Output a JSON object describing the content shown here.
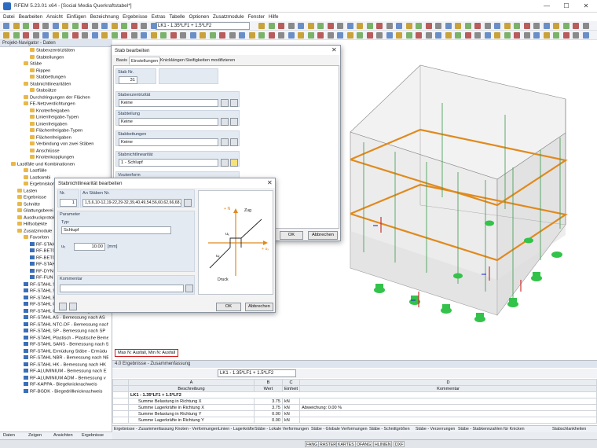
{
  "window": {
    "title": "RFEM 5.23.01 x64 - [Social Media Querkraftstabel*]",
    "minimize": "—",
    "maximize": "☐",
    "close": "✕"
  },
  "menu": [
    "Datei",
    "Bearbeiten",
    "Ansicht",
    "Einfügen",
    "Bezeichnung",
    "Ergebnisse",
    "Extras",
    "Tabelle",
    "Optionen",
    "Zusatzmodule",
    "Fenster",
    "Hilfe"
  ],
  "toolbar": {
    "loadcase_combo": "LK1 - 1.35*LF1 + 1.5*LF2",
    "result_combo": "LK1 - 1.35*LF1 + 1.5*LF2"
  },
  "navigator": {
    "title": "Projekt-Navigator - Daten",
    "items": [
      "Stabexzentrizitäten",
      "Stabteilungen",
      "Stäbe",
      "Rippen",
      "Stabbettungen",
      "Stabnichtlinearitäten",
      "Stabsätze",
      "Durchdringungen der Flächen",
      "FE-Netzverdichtungen",
      "Knotenfreigaben",
      "Linienfreigabe-Typen",
      "Linienfreigaben",
      "Flächenfreigabe-Typen",
      "Flächenfreigaben",
      "Verbindung von zwei Stäben",
      "Anschlüsse",
      "Knotenkopplungen",
      "Lastfälle und Kombinationen",
      "Lastfälle",
      "Lastkombi",
      "Ergebniskom",
      "Lasten",
      "Ergebnisse",
      "Schnitte",
      "Glattungsberei",
      "Ausdruckprotok",
      "Hilfsobjekte",
      "Zusatzmodule",
      "Favoriten",
      "RF-STAH",
      "RF-BETO",
      "RF-BETO",
      "RF-STAH",
      "RF-DYN",
      "RF-FUN",
      "RF-STAHL Stäbe",
      "RF-STAHL SIA - Bemessung nach SIA",
      "RF-STAHL BS - Bemessung nach BS",
      "RF-STAHL GB - Bemessung nach GB",
      "RF-STAHL CSA - Bemessung nach CS",
      "RF-STAHL AS - Bemessung nach AS",
      "RF-STAHL NTC-DF - Bemessung nach",
      "RF-STAHL SP - Bemessung nach SP",
      "RF-STAHL Plastisch - Plastische Beme",
      "RF-STAHL SANS - Bemessung nach SA",
      "RF-STAHL Ermüdung Stäbe - Ermüdu",
      "RF-STAHL NBR - Bemessung nach NB",
      "RF-STAHL HK - Bemessung nach HK",
      "RF-ALUMINIUM - Bemessung nach E",
      "RF-ALUMINIUM ADM - Bemessung v",
      "RF-KAPPA - Biegeknicknachweis",
      "RF-BGDK - Biegedrillknicknachweis"
    ],
    "tabs": [
      "Daten",
      "Zeigen",
      "Ansichten",
      "Ergebnisse"
    ]
  },
  "dialog_stab": {
    "title": "Stab bearbeiten",
    "tabs": [
      "Basis",
      "Einstellungen",
      "Knicklängen",
      "Steifigkeiten modifizieren"
    ],
    "stab_nr_label": "Stab Nr.",
    "stab_nr": "31",
    "exz_label": "Stabexzentrizität",
    "exz_value": "Keine",
    "teilung_label": "Stabteilung",
    "teilung_value": "Keine",
    "bettung_label": "Stabbettungen",
    "bettung_value": "Keine",
    "nl_label": "Stabnichtlinearität",
    "nl_value": "1 - Schlupf",
    "voute_label": "Voutenform",
    "ok": "OK",
    "cancel": "Abbrechen"
  },
  "dialog_nl": {
    "title": "Stabnichtlinearität bearbeiten",
    "nr_label": "Nr.",
    "nr": "1",
    "staebe_label": "An Stäben Nr.",
    "staebe": "1,5,6,10-12,19-22,29-32,39,40,49,54,56,60,62,66,68,72",
    "param_label": "Parameter",
    "typ_label": "Typ:",
    "typ_value": "Schlupf",
    "ux_label": "uₓ",
    "ux_value": "10.00",
    "ux_unit": "[mm]",
    "comment_label": "Kommentar",
    "diagram": {
      "zug": "Zug",
      "druck": "Druck",
      "n": "+ N",
      "ux_axis": "+ uₓ",
      "ux_pos": "uₓ",
      "ux_neg": "uₓ"
    },
    "ok": "OK",
    "cancel": "Abbrechen"
  },
  "view": {
    "legend": "Max N: Ausfall, Min N: Ausfall"
  },
  "results": {
    "title": "4.0 Ergebnisse - Zusammenfassung",
    "combo": "LK1 - 1.35*LF1 + 1.5*LF2",
    "col_letters": [
      "A",
      "B",
      "C",
      "D"
    ],
    "columns": [
      "Beschreibung",
      "Wert",
      "Einheit",
      "Kommentar"
    ],
    "group": "LK1 - 1.35*LF1 + 1.5*LF2",
    "rows": [
      {
        "desc": "Summe Belastung in Richtung X",
        "val": "3.75",
        "unit": "kN",
        "comment": ""
      },
      {
        "desc": "Summe Lagerkräfte in Richtung X",
        "val": "3.75",
        "unit": "kN",
        "comment": "Abweichung:  0.00 %"
      },
      {
        "desc": "Summe Belastung in Richtung Y",
        "val": "0.00",
        "unit": "kN",
        "comment": ""
      },
      {
        "desc": "Summe Lagerkräfte in Richtung Y",
        "val": "0.00",
        "unit": "kN",
        "comment": ""
      }
    ],
    "tabs": [
      "Ergebnisse - Zusammenfassung",
      "Knoten - Verformungen",
      "Linien - Lagerkräfte",
      "Stäbe - Lokale Verformungen",
      "Stäbe - Globale Verformungen",
      "Stäbe - Schnittgrößen",
      "Stäbe - Verzerrungen",
      "Stäbe - Stabkennzahlen für Knicken",
      "Stabschlankheiten"
    ]
  },
  "status": [
    "FANG",
    "RASTER",
    "KARTES",
    "OFANG",
    "HLINIEN",
    "DXF"
  ],
  "colors": {
    "orange": "#e08a1e",
    "green": "#33c24a",
    "red_frame": "#d11a1a"
  }
}
